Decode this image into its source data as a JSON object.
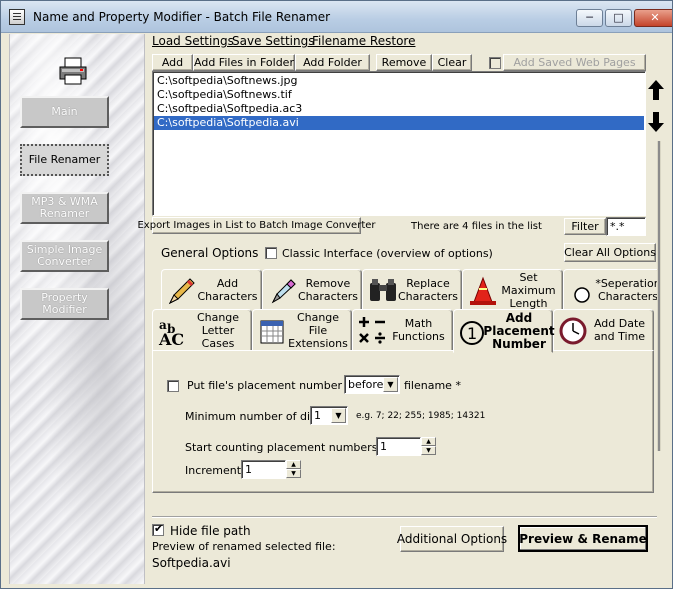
{
  "window": {
    "title": "Name and Property Modifier - Batch File Renamer",
    "controls": {
      "minimize": "─",
      "maximize": "□",
      "close": "✕"
    }
  },
  "sidebar": {
    "items": [
      {
        "label": "Main"
      },
      {
        "label": "File Renamer",
        "active": true
      },
      {
        "label": "MP3 & WMA Renamer"
      },
      {
        "label": "Simple Image Converter"
      },
      {
        "label": "Property Modifier"
      }
    ]
  },
  "menu": {
    "load": "Load Settings",
    "save": "Save Settings",
    "restore": "Filename Restore"
  },
  "toolbar": {
    "add": "Add",
    "add_files_in_folder": "Add Files in Folder",
    "add_folder": "Add Folder",
    "remove": "Remove",
    "clear": "Clear",
    "add_saved_web_pages": "Add Saved Web Pages"
  },
  "files": [
    "C:\\softpedia\\Softnews.jpg",
    "C:\\softpedia\\Softnews.tif",
    "C:\\softpedia\\Softpedia.ac3",
    "C:\\softpedia\\Softpedia.avi"
  ],
  "selected_file_index": 3,
  "list_footer": {
    "export_button": "Export Images in List to Batch Image Converter",
    "count_text": "There are 4 files in the list",
    "filter_button": "Filter",
    "filter_value": "*.*"
  },
  "options": {
    "general_label": "General Options",
    "classic_interface": "Classic Interface (overview of options)",
    "clear_all": "Clear All Options"
  },
  "tabs_row1": [
    {
      "label": "Add Characters",
      "icon": "pencil-icon"
    },
    {
      "label": "Remove Characters",
      "icon": "eraser-icon"
    },
    {
      "label": "Replace Characters",
      "icon": "binoculars-icon"
    },
    {
      "label": "Set Maximum Length",
      "icon": "cone-icon"
    },
    {
      "label": "*Seperation Characters",
      "icon": "radio-icon"
    }
  ],
  "tabs_row2": [
    {
      "label": "Change Letter Cases",
      "icon": "abc-icon"
    },
    {
      "label": "Change File Extensions",
      "icon": "calendar-icon"
    },
    {
      "label": "Math Functions",
      "icon": "math-icon"
    },
    {
      "label": "Add Placement Number",
      "icon": "circled-one-icon",
      "active": true
    },
    {
      "label": "Add Date and Time",
      "icon": "clock-icon"
    }
  ],
  "placement": {
    "put_label": "Put file's placement number in list",
    "position_value": "before",
    "filename_label": "filename *",
    "min_digits_label": "Minimum number of digits:",
    "min_digits_value": "1",
    "example": "e.g. 7; 22; 255; 1985; 14321",
    "start_label": "Start counting placement numbers from:",
    "start_value": "1",
    "increment_label": "Increment:",
    "increment_value": "1"
  },
  "bottom": {
    "hide_path": "Hide file path",
    "preview_label": "Preview of renamed selected file:",
    "preview_value": "Softpedia.avi",
    "additional_options": "Additional Options",
    "preview_rename": "Preview & Rename"
  }
}
